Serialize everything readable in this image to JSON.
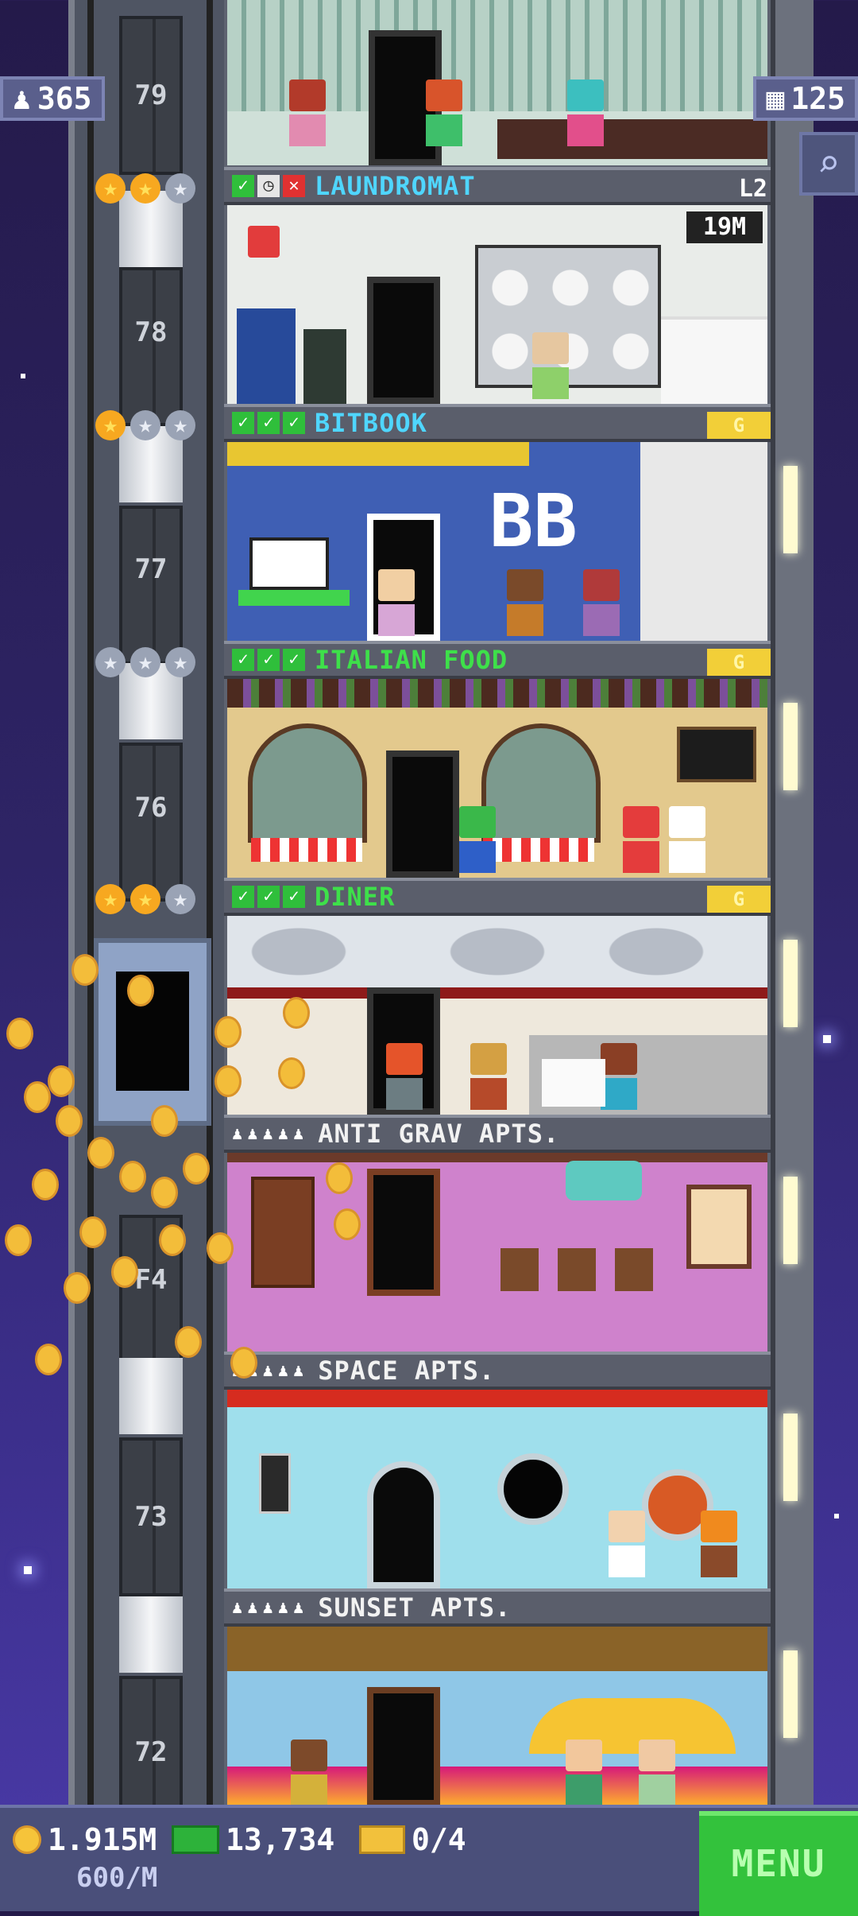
{
  "top": {
    "population": "365",
    "floors": "125"
  },
  "shaft_numbers": [
    "79",
    "78",
    "77",
    "76",
    "F4",
    "73",
    "72"
  ],
  "floors": [
    {
      "name": "LAUNDROMAT",
      "level": "L2",
      "timer": "19M"
    },
    {
      "name": "BITBOOK",
      "badge": "G",
      "sign": "BB"
    },
    {
      "name": "ITALIAN FOOD",
      "badge": "G"
    },
    {
      "name": "DINER",
      "badge": "G"
    },
    {
      "name": "ANTI GRAV APTS."
    },
    {
      "name": "SPACE APTS."
    },
    {
      "name": "SUNSET APTS."
    }
  ],
  "bottom": {
    "coins": "1.915M",
    "rate": "600/M",
    "bux": "13,734",
    "tickets": "0/4",
    "menu": "MENU"
  }
}
